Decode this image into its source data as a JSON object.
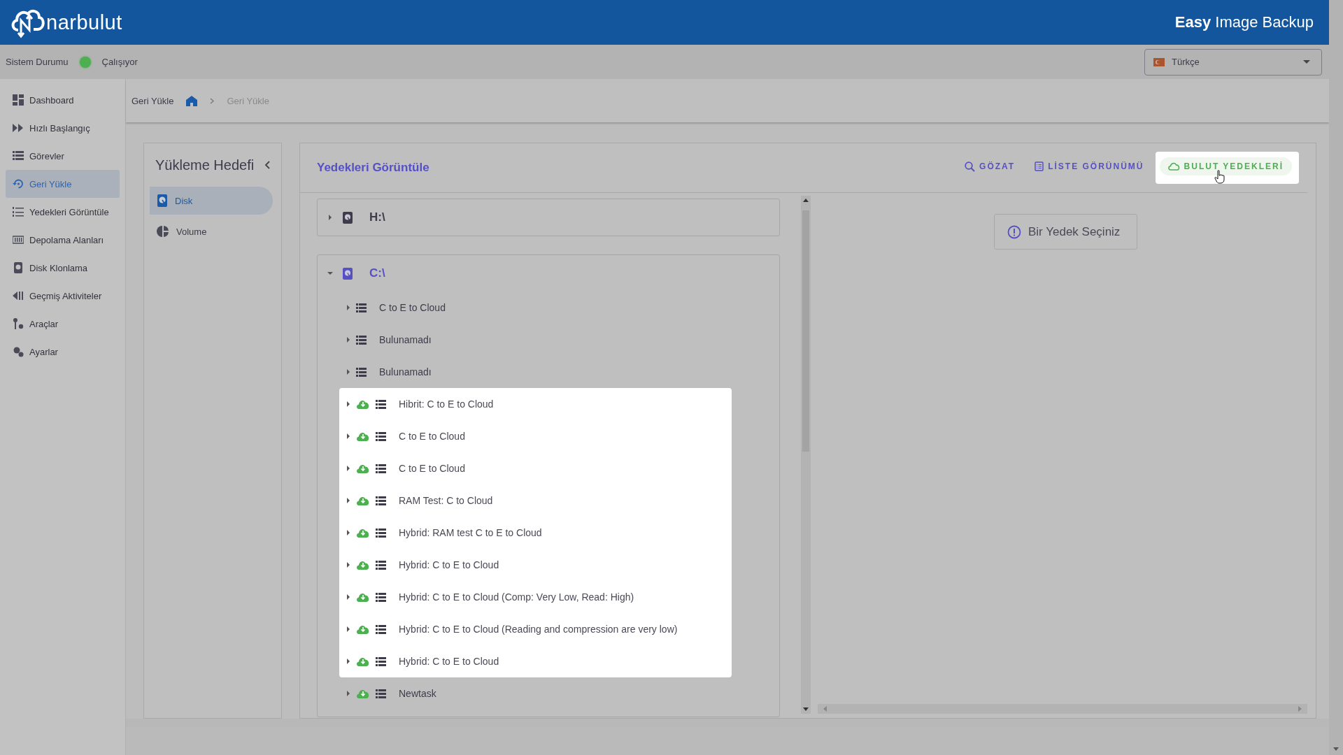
{
  "header": {
    "logo": "narbulut",
    "product": "**Easy** Image Backup"
  },
  "status_bar": {
    "label": "Sistem Durumu",
    "status": "Çalışıyor",
    "color": "#4caf50",
    "language": "Türkçe"
  },
  "sidebar": {
    "items": [
      {
        "label": "Dashboard",
        "selected": false
      },
      {
        "label": "Hızlı Başlangıç",
        "selected": false
      },
      {
        "label": "Görevler",
        "selected": false
      },
      {
        "label": "Geri Yükle",
        "selected": true
      },
      {
        "label": "Yedekleri Görüntüle",
        "selected": false
      },
      {
        "label": "Depolama Alanları",
        "selected": false
      },
      {
        "label": "Disk Klonlama",
        "selected": false
      },
      {
        "label": "Geçmiş Aktiviteler",
        "selected": false
      },
      {
        "label": "Araçlar",
        "selected": false
      },
      {
        "label": "Ayarlar",
        "selected": false
      }
    ]
  },
  "breadcrumb": {
    "items": [
      "Geri Yükle",
      "Geri Yükle"
    ]
  },
  "target_panel": {
    "title": "Yükleme Hedefi",
    "items": [
      {
        "label": "Disk",
        "kind": "disk",
        "selected": true
      },
      {
        "label": "Volume",
        "kind": "volume",
        "selected": false
      }
    ]
  },
  "backups_panel": {
    "title": "Yedekleri Görüntüle",
    "toolbar": [
      {
        "label": "GÖZAT",
        "kind": "browse",
        "highlighted": false
      },
      {
        "label": "LİSTE GÖRÜNÜMÜ",
        "kind": "list",
        "highlighted": false
      },
      {
        "label": "BULUT YEDEKLERİ",
        "kind": "cloud",
        "highlighted": true
      }
    ],
    "drives": [
      {
        "label": "H:\\",
        "expanded": false,
        "selected": false
      },
      {
        "label": "C:\\",
        "expanded": true,
        "selected": true,
        "children": [
          {
            "label": "C to E to Cloud",
            "cloud": false,
            "highlighted": false
          },
          {
            "label": "Bulunamadı",
            "cloud": false,
            "highlighted": false
          },
          {
            "label": "Bulunamadı",
            "cloud": false,
            "highlighted": false
          },
          {
            "label": "Hibrit: C to E to Cloud",
            "cloud": true,
            "highlighted": true
          },
          {
            "label": "C to E to Cloud",
            "cloud": true,
            "highlighted": true
          },
          {
            "label": "C to E to Cloud",
            "cloud": true,
            "highlighted": true
          },
          {
            "label": "RAM Test: C to Cloud",
            "cloud": true,
            "highlighted": true
          },
          {
            "label": "Hybrid: RAM test C to E to Cloud",
            "cloud": true,
            "highlighted": true
          },
          {
            "label": "Hybrid: C to E to Cloud",
            "cloud": true,
            "highlighted": true
          },
          {
            "label": "Hybrid: C to E to Cloud (Comp: Very Low, Read: High)",
            "cloud": true,
            "highlighted": true
          },
          {
            "label": "Hybrid: C to E to Cloud (Reading and compression are very low)",
            "cloud": true,
            "highlighted": true
          },
          {
            "label": "Hybrid: C to E to Cloud",
            "cloud": true,
            "highlighted": true
          },
          {
            "label": "Newtask",
            "cloud": true,
            "highlighted": false
          }
        ]
      }
    ],
    "empty_message": "Bir Yedek Seçiniz"
  }
}
